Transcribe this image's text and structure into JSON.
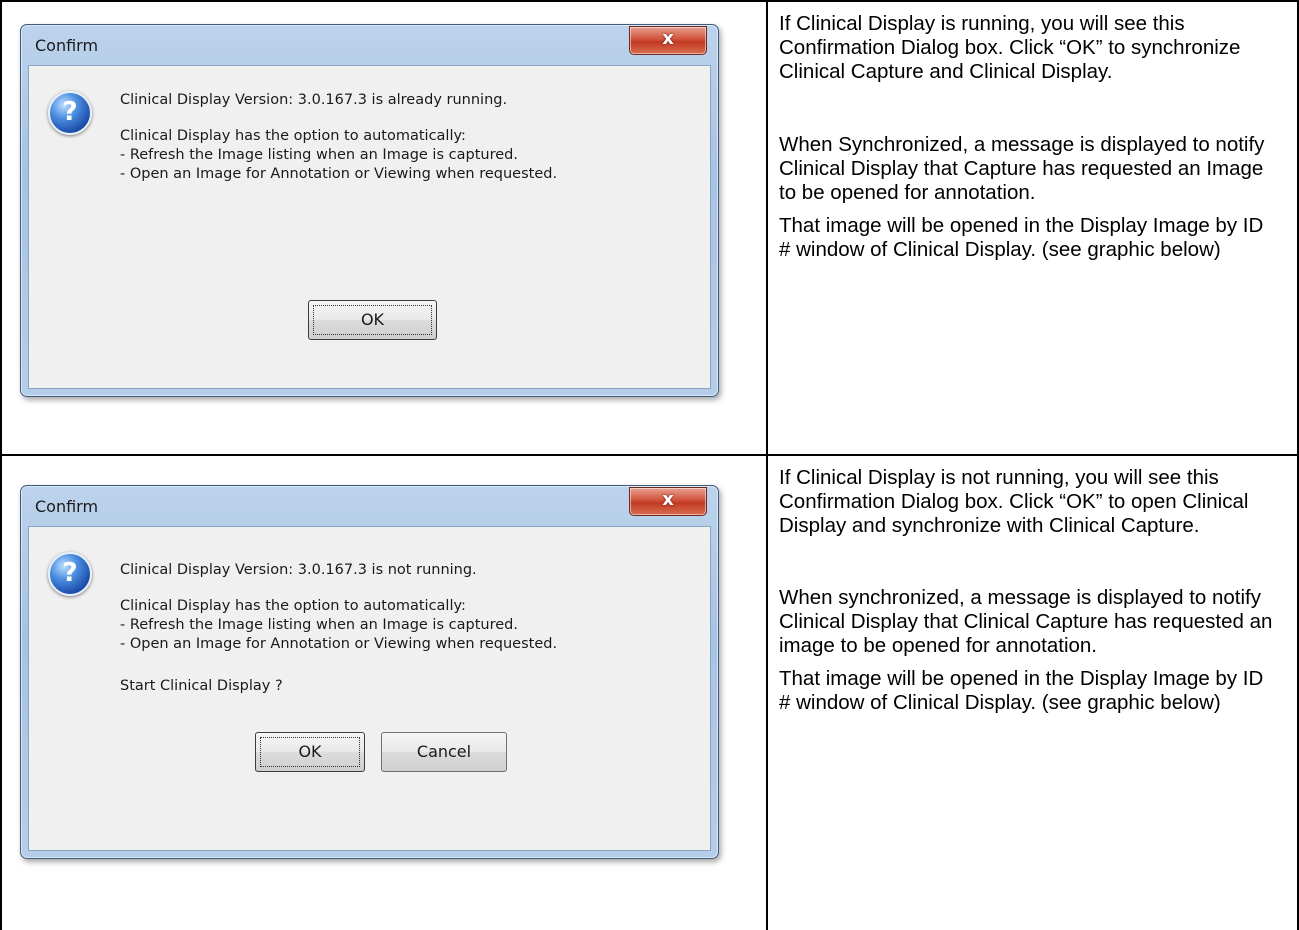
{
  "row1": {
    "dialog": {
      "title": "Confirm",
      "close_label": "x",
      "icon_glyph": "?",
      "line1": "Clinical Display Version: 3.0.167.3 is already running.",
      "line2": "Clinical Display has the option to automatically:",
      "line3": "- Refresh the Image listing when an Image is captured.",
      "line4": "- Open an Image for Annotation or Viewing when requested.",
      "ok_label": "OK"
    },
    "description": {
      "p1": "If Clinical Display is running, you will see this Confirmation Dialog box. Click “OK” to synchronize Clinical Capture and Clinical Display.",
      "p2": "When Synchronized, a message  is displayed  to notify Clinical Display that Capture has requested an Image to be opened for annotation.",
      "p3": "That image will be opened in the Display Image by ID # window of Clinical Display. (see graphic below)"
    }
  },
  "row2": {
    "dialog": {
      "title": "Confirm",
      "close_label": "x",
      "icon_glyph": "?",
      "line1": "Clinical Display Version: 3.0.167.3 is not running.",
      "line2": "Clinical Display has the option to automatically:",
      "line3": "- Refresh the Image listing when an Image is captured.",
      "line4": "- Open an Image for Annotation or Viewing when requested.",
      "line5": "Start Clinical Display ?",
      "ok_label": "OK",
      "cancel_label": "Cancel"
    },
    "description": {
      "p1": "If Clinical Display is not running, you will see this Confirmation Dialog box. Click “OK” to open Clinical Display and synchronize with Clinical Capture.",
      "p2": "When synchronized, a message is displayed to notify Clinical Display that Clinical Capture has requested an image to be opened for annotation.",
      "p3": "That image will be opened in the Display Image by ID # window of Clinical Display. (see graphic below)"
    }
  }
}
